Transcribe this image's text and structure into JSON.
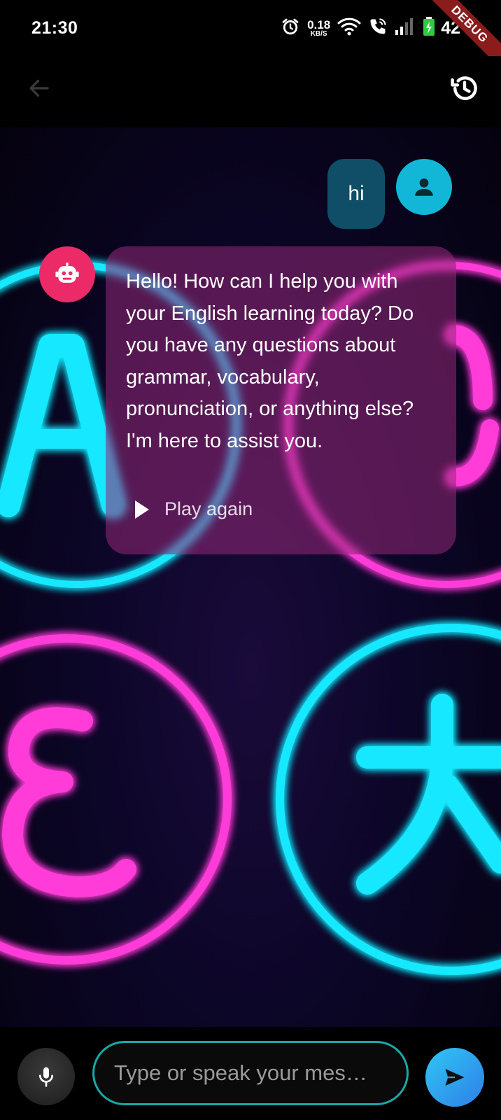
{
  "status_bar": {
    "time": "21:30",
    "net_speed_value": "0.18",
    "net_speed_unit": "KB/S",
    "battery_percent": "42",
    "icons": [
      "alarm-icon",
      "wifi-icon",
      "wifi-call-icon",
      "signal-icon",
      "battery-charging-icon"
    ]
  },
  "debug_banner": "DEBUG",
  "app_bar": {
    "back_icon": "arrow-back-icon",
    "history_icon": "history-icon"
  },
  "messages": [
    {
      "role": "user",
      "text": "hi"
    },
    {
      "role": "bot",
      "text": "Hello! How can I help you with your English learning today? Do you have any questions about grammar, vocabulary, pronunciation, or anything else? I'm here to assist you.",
      "play_label": "Play again"
    }
  ],
  "input": {
    "placeholder": "Type or speak your mes…"
  },
  "colors": {
    "user_bubble": "#0f4e66",
    "user_avatar": "#12b7d8",
    "bot_avatar": "#ec2a68",
    "bot_bubble": "#962878",
    "input_border": "#1ba8a8",
    "send_button": "#2f9ff0",
    "neon_cyan": "#18e8ff",
    "neon_magenta": "#ff3ad8"
  }
}
